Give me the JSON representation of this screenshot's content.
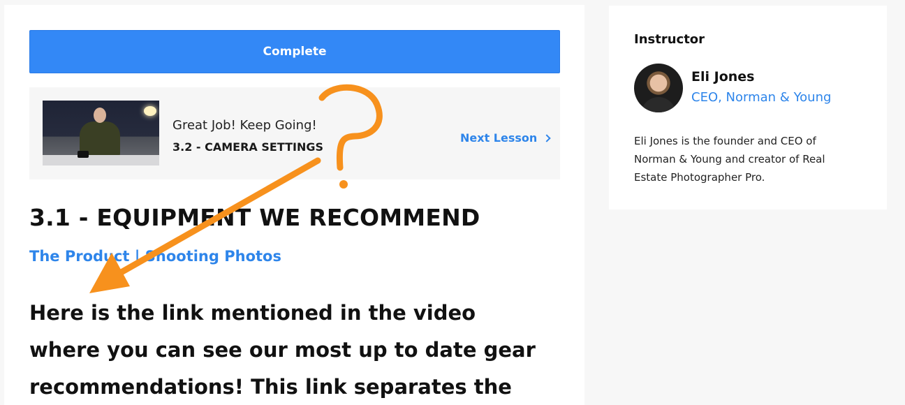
{
  "complete_button": {
    "label": "Complete"
  },
  "next_lesson": {
    "encouragement": "Great Job! Keep Going!",
    "lesson_title": "3.2 - CAMERA SETTINGS",
    "link_label": "Next Lesson",
    "icon": "chevron-right-icon"
  },
  "lesson": {
    "title": "3.1 - EQUIPMENT WE RECOMMEND",
    "breadcrumb": "The Product | Shooting Photos",
    "body_lines": [
      "Here is the link mentioned in the video",
      "where you can see our most up to date gear",
      "recommendations! This link separates the"
    ]
  },
  "instructor": {
    "heading": "Instructor",
    "name": "Eli Jones",
    "role": "CEO, Norman & Young",
    "bio": "Eli Jones is the founder and CEO of Norman & Young and creator of Real Estate Photographer Pro."
  },
  "colors": {
    "accent_blue": "#3388f6",
    "link_blue": "#2e85ea",
    "annotation_orange": "#f7911d"
  }
}
